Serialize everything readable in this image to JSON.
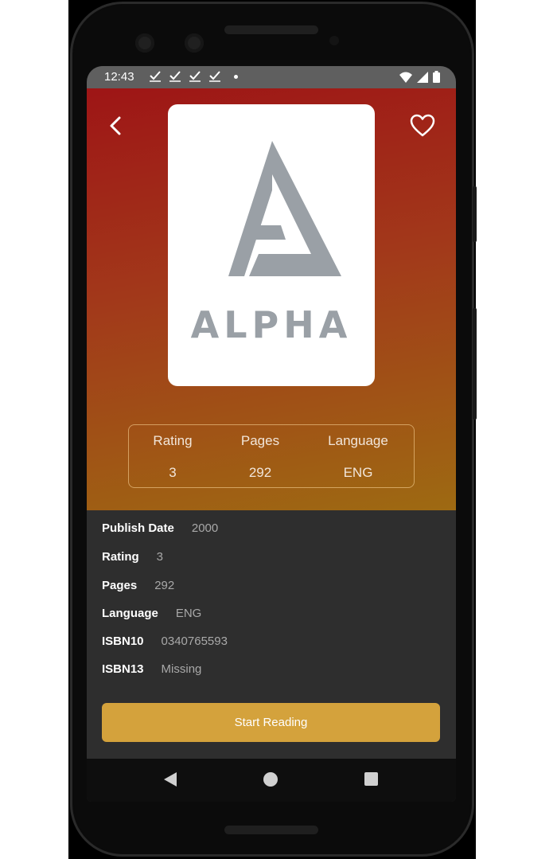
{
  "status_bar": {
    "time": "12:43",
    "notification_icons": [
      "check-icon",
      "check-icon",
      "check-icon",
      "check-icon"
    ],
    "system_icons": [
      "wifi-icon",
      "signal-icon",
      "battery-icon"
    ]
  },
  "header": {
    "back_icon": "chevron-left-icon",
    "favorite_icon": "heart-outline-icon"
  },
  "cover": {
    "logo_text": "ALPHA",
    "logo_color": "#9aa0a6"
  },
  "stats": [
    {
      "label": "Rating",
      "value": "3"
    },
    {
      "label": "Pages",
      "value": "292"
    },
    {
      "label": "Language",
      "value": "ENG"
    }
  ],
  "details": [
    {
      "key": "Publish Date",
      "value": "2000"
    },
    {
      "key": "Rating",
      "value": "3"
    },
    {
      "key": "Pages",
      "value": "292"
    },
    {
      "key": "Language",
      "value": "ENG"
    },
    {
      "key": "ISBN10",
      "value": "0340765593"
    },
    {
      "key": "ISBN13",
      "value": "Missing"
    }
  ],
  "cta": {
    "label": "Start Reading"
  },
  "colors": {
    "hero_top": "#9e1516",
    "hero_bottom": "#9e6a12",
    "accent_button": "#d4a23c",
    "details_background": "#2e2e2e"
  },
  "nav_bar": {
    "icons": [
      "nav-back-icon",
      "nav-home-icon",
      "nav-recents-icon"
    ]
  }
}
